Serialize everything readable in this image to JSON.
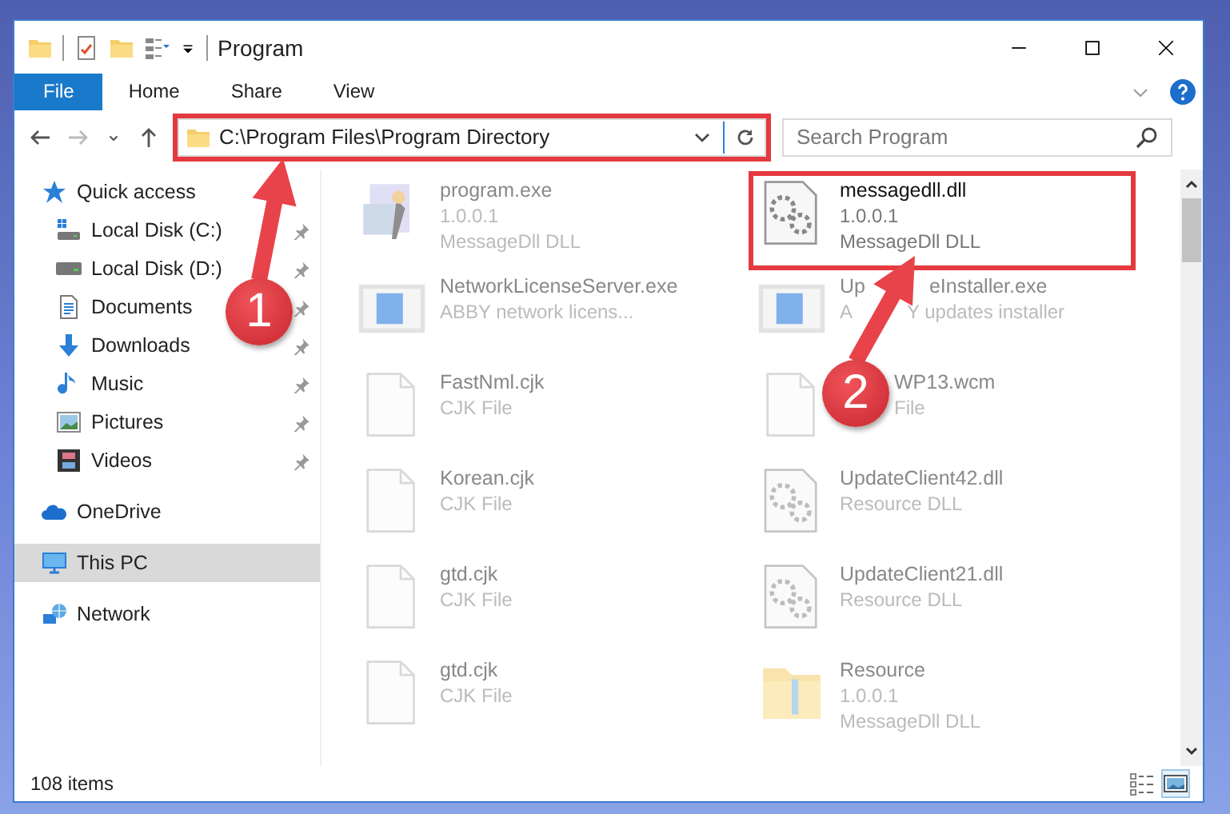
{
  "window": {
    "title": "Program"
  },
  "ribbon_tabs": [
    {
      "label": "File",
      "kind": "file"
    },
    {
      "label": "Home",
      "kind": "tab"
    },
    {
      "label": "Share",
      "kind": "tab"
    },
    {
      "label": "View",
      "kind": "tab"
    }
  ],
  "address": {
    "path": "C:\\Program Files\\Program Directory",
    "highlighted": true
  },
  "search": {
    "placeholder": "Search Program"
  },
  "sidebar": {
    "items": [
      {
        "label": "Quick access",
        "selected": false,
        "children": [
          {
            "label": "Local Disk (C:)",
            "pinned": true,
            "selected": false
          },
          {
            "label": "Local Disk (D:)",
            "pinned": true,
            "selected": false
          },
          {
            "label": "Documents",
            "pinned": true,
            "selected": false
          },
          {
            "label": "Downloads",
            "pinned": true,
            "selected": false
          },
          {
            "label": "Music",
            "pinned": true,
            "selected": false
          },
          {
            "label": "Pictures",
            "pinned": true,
            "selected": false
          },
          {
            "label": "Videos",
            "pinned": true,
            "selected": false
          }
        ]
      },
      {
        "label": "OneDrive",
        "selected": false
      },
      {
        "label": "This PC",
        "selected": true
      },
      {
        "label": "Network",
        "selected": false
      }
    ]
  },
  "files": [
    {
      "kind": "app",
      "name": [
        "program.exe"
      ],
      "details": [
        [
          "1.0.0.1"
        ],
        [
          "MessageDll DLL"
        ]
      ],
      "faded": true,
      "highlighted": false
    },
    {
      "kind": "dll",
      "name": [
        "messagedll.dll"
      ],
      "details": [
        [
          "1.0.0.1"
        ],
        [
          "MessageDll DLL"
        ]
      ],
      "faded": false,
      "highlighted": true
    },
    {
      "kind": "window",
      "name": [
        "NetworkLicenseServer.exe"
      ],
      "details": [
        [
          "ABBY network licens..."
        ]
      ],
      "faded": true,
      "highlighted": false
    },
    {
      "kind": "window",
      "name": [
        "Up",
        "eInstaller.exe"
      ],
      "details": [
        [
          "A",
          "Y updates installer"
        ]
      ],
      "faded": true,
      "highlighted": false
    },
    {
      "kind": "blank",
      "name": [
        "FastNml.cjk"
      ],
      "details": [
        [
          "CJK File"
        ]
      ],
      "faded": true,
      "highlighted": false
    },
    {
      "kind": "blank",
      "name": [
        "WP13.wcm"
      ],
      "details": [
        [
          "File"
        ]
      ],
      "faded": true,
      "highlighted": false
    },
    {
      "kind": "blank",
      "name": [
        "Korean.cjk"
      ],
      "details": [
        [
          "CJK File"
        ]
      ],
      "faded": true,
      "highlighted": false
    },
    {
      "kind": "dll",
      "name": [
        "UpdateClient42.dll"
      ],
      "details": [
        [
          "Resource DLL"
        ]
      ],
      "faded": true,
      "highlighted": false
    },
    {
      "kind": "blank",
      "name": [
        "gtd.cjk"
      ],
      "details": [
        [
          "CJK File"
        ]
      ],
      "faded": true,
      "highlighted": false
    },
    {
      "kind": "dll",
      "name": [
        "UpdateClient21.dll"
      ],
      "details": [
        [
          "Resource DLL"
        ]
      ],
      "faded": true,
      "highlighted": false
    },
    {
      "kind": "blank",
      "name": [
        "gtd.cjk"
      ],
      "details": [
        [
          "CJK File"
        ]
      ],
      "faded": true,
      "highlighted": false
    },
    {
      "kind": "folder",
      "name": [
        "Resource"
      ],
      "details": [
        [
          "1.0.0.1"
        ],
        [
          "MessageDll DLL"
        ]
      ],
      "faded": true,
      "highlighted": false
    }
  ],
  "status_bar": {
    "count": "108 items"
  },
  "annotations": [
    {
      "number": "1"
    },
    {
      "number": "2"
    }
  ]
}
